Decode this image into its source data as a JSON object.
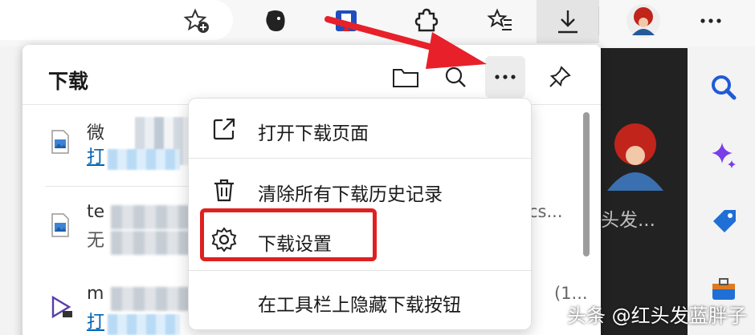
{
  "panel": {
    "title": "下载"
  },
  "downloads": [
    {
      "name": "微",
      "sub": "打",
      "right": ""
    },
    {
      "name": "te",
      "sub": "无",
      "right": "cs..."
    },
    {
      "name": "m",
      "sub": "打",
      "right": "(1..."
    }
  ],
  "menu": {
    "items": [
      {
        "label": "打开下载页面"
      },
      {
        "label": "清除所有下载历史记录"
      },
      {
        "label": "下载设置"
      },
      {
        "label": "在工具栏上隐藏下载按钮"
      }
    ]
  },
  "dark_pane": {
    "name": "头发..."
  },
  "watermark": "头条 @红头发蓝胖子",
  "colors": {
    "accent": "#0063b1",
    "highlight": "#e02020",
    "arrow": "#e8202a"
  }
}
